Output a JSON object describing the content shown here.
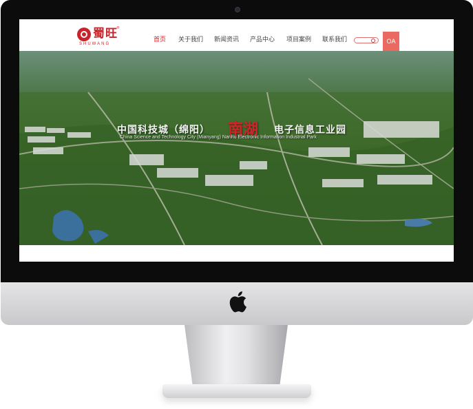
{
  "nav": {
    "items": [
      {
        "label": "首页",
        "active": true
      },
      {
        "label": "关于我们",
        "active": false
      },
      {
        "label": "新闻资讯",
        "active": false
      },
      {
        "label": "产品中心",
        "active": false
      },
      {
        "label": "项目案例",
        "active": false
      },
      {
        "label": "联系我们",
        "active": false
      }
    ],
    "oa_label": "OA"
  },
  "logo": {
    "text": "蜀旺",
    "subtext": "SHUWANG",
    "reg": "®"
  },
  "banner": {
    "title_part1": "中国科技城（绵阳）",
    "title_highlight": "南湖",
    "title_part2": "电子信息工业园",
    "subtitle": "China Science and Technology City (Mianyang) Nanhu Electronic Information Industrial Park"
  },
  "colors": {
    "accent": "#d2232a",
    "oa_button": "#ea6a61",
    "bezel": "#0c0c0c"
  },
  "icons": {
    "search": "search-icon",
    "apple": "apple-logo"
  }
}
